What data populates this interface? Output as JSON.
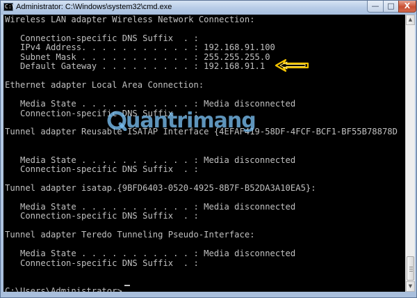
{
  "window": {
    "title": "Administrator: C:\\Windows\\system32\\cmd.exe",
    "icon_glyph": "C:\\",
    "controls": {
      "minimize": "—",
      "maximize": "□",
      "close": "X"
    }
  },
  "console": {
    "lines": [
      "Wireless LAN adapter Wireless Network Connection:",
      "",
      "   Connection-specific DNS Suffix  . :",
      "   IPv4 Address. . . . . . . . . . . : 192.168.91.100",
      "   Subnet Mask . . . . . . . . . . . : 255.255.255.0",
      "   Default Gateway . . . . . . . . . : 192.168.91.1",
      "",
      "Ethernet adapter Local Area Connection:",
      "",
      "   Media State . . . . . . . . . . . : Media disconnected",
      "   Connection-specific DNS Suffix  . :",
      "",
      "Tunnel adapter Reusable ISATAP Interface {4EFAF419-58DF-4FCF-BCF1-BF55B78878D",
      "",
      "",
      "   Media State . . . . . . . . . . . : Media disconnected",
      "   Connection-specific DNS Suffix  . :",
      "",
      "Tunnel adapter isatap.{9BFD6403-0520-4925-8B7F-B52DA3A10EA5}:",
      "",
      "   Media State . . . . . . . . . . . : Media disconnected",
      "   Connection-specific DNS Suffix  . :",
      "",
      "Tunnel adapter Teredo Tunneling Pseudo-Interface:",
      "",
      "   Media State . . . . . . . . . . . : Media disconnected",
      "   Connection-specific DNS Suffix  . :",
      "",
      "",
      "C:\\Users\\Administrator>"
    ]
  },
  "watermark": {
    "text": "uantrimang",
    "mark": "quantrimang-logo"
  },
  "annotation": {
    "icon": "yellow-arrow-icon",
    "color": "#f5c400"
  },
  "scrollbar": {
    "up_icon": "▲",
    "down_icon": "▼"
  }
}
